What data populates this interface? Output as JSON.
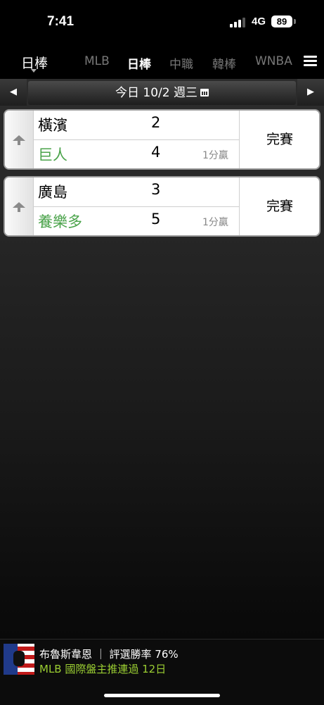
{
  "status_bar": {
    "time": "7:41",
    "network": "4G",
    "battery": "89"
  },
  "nav": {
    "current_league": "日棒",
    "tabs": [
      {
        "label": "MLB",
        "active": false
      },
      {
        "label": "日棒",
        "active": true
      },
      {
        "label": "中職",
        "active": false
      },
      {
        "label": "韓棒",
        "active": false
      },
      {
        "label": "WNBA",
        "active": false
      }
    ]
  },
  "date_bar": {
    "date_label": "今日 10/2 週三",
    "prev_symbol": "◀",
    "next_symbol": "▶"
  },
  "games": [
    {
      "away_team": "橫濱",
      "away_score": "2",
      "home_team": "巨人",
      "home_score": "4",
      "result_note": "1分贏",
      "status": "完賽"
    },
    {
      "away_team": "廣島",
      "away_score": "3",
      "home_team": "養樂多",
      "home_score": "5",
      "result_note": "1分贏",
      "status": "完賽"
    }
  ],
  "ad": {
    "line1": "布魯斯韋恩 ｜ 評選勝率 76%",
    "line2": "MLB 國際盤主推連過 12日"
  },
  "colors": {
    "home_team": "#4aa34a",
    "ad_highlight": "#9acd32",
    "background": "#1a1a1a"
  }
}
